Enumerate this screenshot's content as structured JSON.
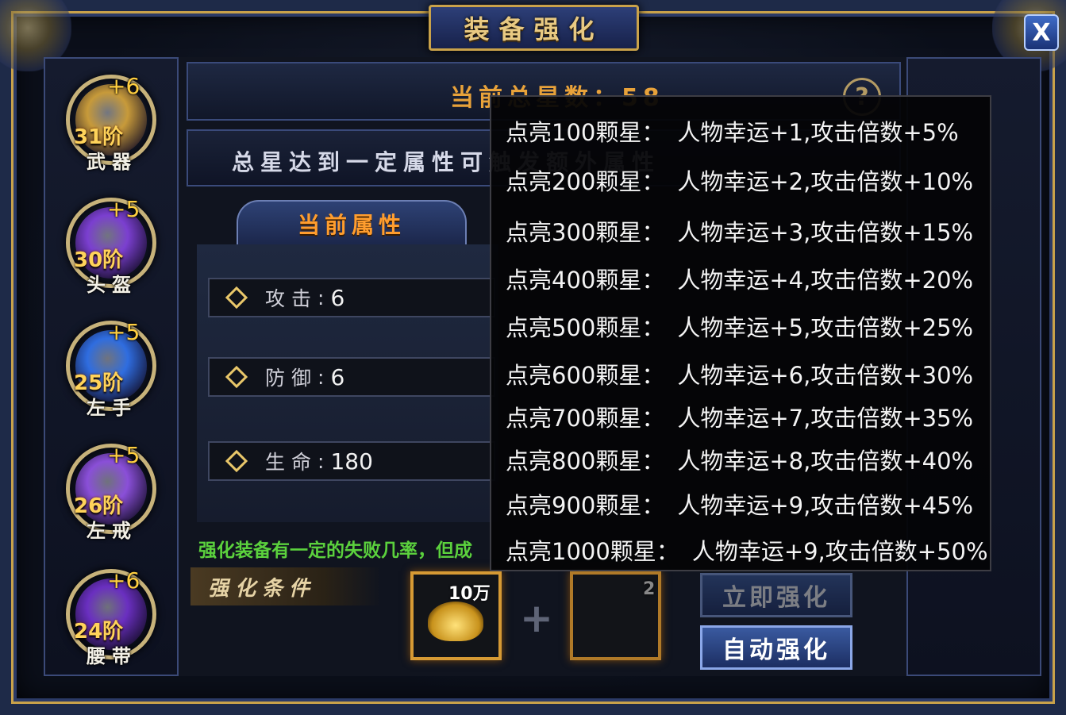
{
  "window": {
    "title": "装备强化",
    "close_label": "X"
  },
  "left_equipment": [
    {
      "plus": "+6",
      "tier": "31阶",
      "slot": "武器",
      "color": "#c79a3a"
    },
    {
      "plus": "+5",
      "tier": "30阶",
      "slot": "头盔",
      "color": "#7b3fd0"
    },
    {
      "plus": "+5",
      "tier": "25阶",
      "slot": "左手",
      "color": "#2f6de0"
    },
    {
      "plus": "+5",
      "tier": "26阶",
      "slot": "左戒",
      "color": "#8a4fd8"
    },
    {
      "plus": "+6",
      "tier": "24阶",
      "slot": "腰带",
      "color": "#6a2fc0"
    }
  ],
  "star_bar": {
    "label": "当前总星数：58",
    "help_icon": "?"
  },
  "hint": {
    "text": "总星达到一定属性可触发额外属性"
  },
  "attributes_tab": {
    "label": "当前属性"
  },
  "attributes": [
    {
      "name": "攻击",
      "value": "6"
    },
    {
      "name": "防御",
      "value": "6"
    },
    {
      "name": "生命",
      "value": "180"
    }
  ],
  "warning": {
    "text": "强化装备有一定的失败几率，但成"
  },
  "conditions": {
    "label": "强化条件",
    "gold_amount": "10万",
    "material_count": "2"
  },
  "buttons": {
    "enhance_now": "立即强化",
    "auto_enhance": "自动强化"
  },
  "tooltip": {
    "lines": [
      {
        "stars": "点亮100颗星：",
        "bonus": "人物幸运+1,攻击倍数+5%"
      },
      {
        "stars": "点亮200颗星：",
        "bonus": "人物幸运+2,攻击倍数+10%"
      },
      {
        "stars": "点亮300颗星：",
        "bonus": "人物幸运+3,攻击倍数+15%"
      },
      {
        "stars": "点亮400颗星：",
        "bonus": "人物幸运+4,攻击倍数+20%"
      },
      {
        "stars": "点亮500颗星：",
        "bonus": "人物幸运+5,攻击倍数+25%"
      },
      {
        "stars": "点亮600颗星：",
        "bonus": "人物幸运+6,攻击倍数+30%"
      },
      {
        "stars": "点亮700颗星：",
        "bonus": "人物幸运+7,攻击倍数+35%"
      },
      {
        "stars": "点亮800颗星：",
        "bonus": "人物幸运+8,攻击倍数+40%"
      },
      {
        "stars": "点亮900颗星：",
        "bonus": "人物幸运+9,攻击倍数+45%"
      },
      {
        "stars": "点亮1000颗星：",
        "bonus": "人物幸运+9,攻击倍数+50%"
      }
    ]
  }
}
